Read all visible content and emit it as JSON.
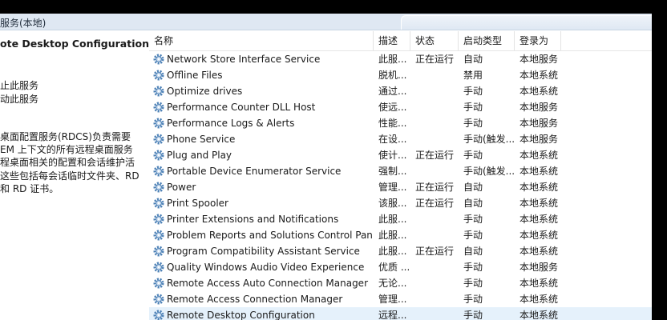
{
  "window": {
    "title": "服务(本地)"
  },
  "left_panel": {
    "title": "ote Desktop Configuration",
    "links": [
      "止此服务",
      "动此服务"
    ],
    "description": [
      "桌面配置服务(RDCS)负责需要",
      "EM 上下文的所有远程桌面服务",
      "程桌面相关的配置和会话维护活",
      "这些包括每会话临时文件夹、RD",
      "和 RD 证书。"
    ]
  },
  "columns": [
    "名称",
    "描述",
    "状态",
    "启动类型",
    "登录为"
  ],
  "sort_indicator": "^",
  "services": [
    {
      "name": "Network Store Interface Service",
      "desc": "此服...",
      "status": "正在运行",
      "startup": "自动",
      "logon": "本地服务"
    },
    {
      "name": "Offline Files",
      "desc": "脱机...",
      "status": "",
      "startup": "禁用",
      "logon": "本地系统"
    },
    {
      "name": "Optimize drives",
      "desc": "通过...",
      "status": "",
      "startup": "手动",
      "logon": "本地系统"
    },
    {
      "name": "Performance Counter DLL Host",
      "desc": "使远...",
      "status": "",
      "startup": "手动",
      "logon": "本地服务"
    },
    {
      "name": "Performance Logs & Alerts",
      "desc": "性能...",
      "status": "",
      "startup": "手动",
      "logon": "本地服务"
    },
    {
      "name": "Phone Service",
      "desc": "在设...",
      "status": "",
      "startup": "手动(触发...",
      "logon": "本地服务"
    },
    {
      "name": "Plug and Play",
      "desc": "使计...",
      "status": "正在运行",
      "startup": "手动",
      "logon": "本地系统"
    },
    {
      "name": "Portable Device Enumerator Service",
      "desc": "强制...",
      "status": "",
      "startup": "手动(触发...",
      "logon": "本地系统"
    },
    {
      "name": "Power",
      "desc": "管理...",
      "status": "正在运行",
      "startup": "自动",
      "logon": "本地系统"
    },
    {
      "name": "Print Spooler",
      "desc": "该服...",
      "status": "正在运行",
      "startup": "自动",
      "logon": "本地系统"
    },
    {
      "name": "Printer Extensions and Notifications",
      "desc": "此服...",
      "status": "",
      "startup": "手动",
      "logon": "本地系统"
    },
    {
      "name": "Problem Reports and Solutions Control Pan...",
      "desc": "此服...",
      "status": "",
      "startup": "手动",
      "logon": "本地系统"
    },
    {
      "name": "Program Compatibility Assistant Service",
      "desc": "此服...",
      "status": "正在运行",
      "startup": "自动",
      "logon": "本地系统"
    },
    {
      "name": "Quality Windows Audio Video Experience",
      "desc": "优质 ...",
      "status": "",
      "startup": "手动",
      "logon": "本地服务"
    },
    {
      "name": "Remote Access Auto Connection Manager",
      "desc": "无论...",
      "status": "",
      "startup": "手动",
      "logon": "本地系统"
    },
    {
      "name": "Remote Access Connection Manager",
      "desc": "管理...",
      "status": "",
      "startup": "手动",
      "logon": "本地系统"
    },
    {
      "name": "Remote Desktop Configuration",
      "desc": "远程...",
      "status": "",
      "startup": "手动",
      "logon": "本地系统",
      "selected": true
    }
  ],
  "colors": {
    "header_bg": "#dfe8f3",
    "selection": "#e5f1fb",
    "gear": "#4a7fb5"
  },
  "icons": {
    "service": "gear-icon"
  }
}
